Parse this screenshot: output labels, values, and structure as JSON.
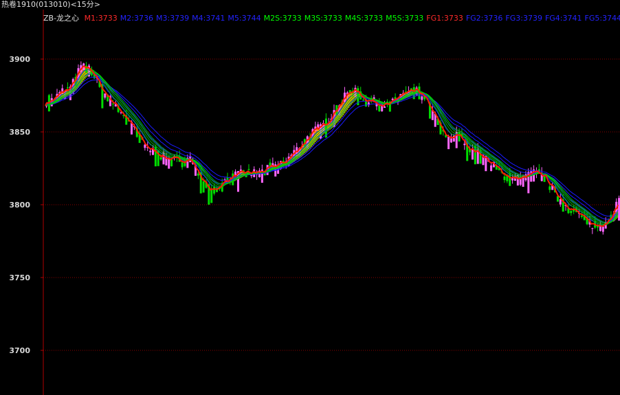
{
  "window": {
    "title": "热卷1910(013010)<15分>"
  },
  "indicator": {
    "name": "ZB-龙之心",
    "entries": [
      {
        "label": "M1:3733",
        "color": "#ff2a2a"
      },
      {
        "label": "M2:3736",
        "color": "#2323ff"
      },
      {
        "label": "M3:3739",
        "color": "#2323ff"
      },
      {
        "label": "M4:3741",
        "color": "#2323ff"
      },
      {
        "label": "M5:3744",
        "color": "#2323ff"
      },
      {
        "label": "M2S:3733",
        "color": "#00ff00"
      },
      {
        "label": "M3S:3733",
        "color": "#00ff00"
      },
      {
        "label": "M4S:3733",
        "color": "#00ff00"
      },
      {
        "label": "M5S:3733",
        "color": "#00ff00"
      },
      {
        "label": "FG1:3733",
        "color": "#ff2a2a"
      },
      {
        "label": "FG2:3736",
        "color": "#2323ff"
      },
      {
        "label": "FG3:3739",
        "color": "#2323ff"
      },
      {
        "label": "FG4:3741",
        "color": "#2323ff"
      },
      {
        "label": "FG5:3744",
        "color": "#2323ff"
      }
    ]
  },
  "colors": {
    "up_candle": "#ff66ff",
    "down_candle": "#00dd00",
    "grid": "#8b0000",
    "axis_text": "#d8d8d8",
    "ribbon_fill": "#ff9900",
    "ribbon_top": "#ff1a00",
    "blue_lines": "#1a1aff",
    "green_lines": "#00cc00"
  },
  "chart_data": {
    "type": "candlestick",
    "y_ticks": [
      "3900",
      "3850",
      "3800",
      "3750",
      "3700"
    ],
    "y_tick_values": [
      3900,
      3850,
      3800,
      3750,
      3700
    ],
    "ylim": [
      3690,
      3930
    ],
    "grid": true,
    "close_anchors": [
      [
        0,
        3871
      ],
      [
        5,
        3872
      ],
      [
        12,
        3878
      ],
      [
        18,
        3880
      ],
      [
        26,
        3895
      ],
      [
        34,
        3893
      ],
      [
        42,
        3878
      ],
      [
        50,
        3870
      ],
      [
        58,
        3862
      ],
      [
        66,
        3852
      ],
      [
        74,
        3840
      ],
      [
        82,
        3836
      ],
      [
        90,
        3832
      ],
      [
        100,
        3830
      ],
      [
        108,
        3832
      ],
      [
        116,
        3818
      ],
      [
        124,
        3808
      ],
      [
        132,
        3815
      ],
      [
        140,
        3820
      ],
      [
        150,
        3822
      ],
      [
        160,
        3822
      ],
      [
        170,
        3826
      ],
      [
        180,
        3830
      ],
      [
        190,
        3840
      ],
      [
        200,
        3850
      ],
      [
        210,
        3856
      ],
      [
        220,
        3870
      ],
      [
        230,
        3880
      ],
      [
        240,
        3872
      ],
      [
        250,
        3870
      ],
      [
        258,
        3868
      ],
      [
        266,
        3876
      ],
      [
        274,
        3877
      ],
      [
        280,
        3878
      ],
      [
        286,
        3870
      ],
      [
        292,
        3860
      ],
      [
        300,
        3845
      ],
      [
        310,
        3848
      ],
      [
        318,
        3838
      ],
      [
        326,
        3835
      ],
      [
        334,
        3828
      ],
      [
        342,
        3822
      ],
      [
        350,
        3818
      ],
      [
        358,
        3818
      ],
      [
        366,
        3822
      ],
      [
        374,
        3820
      ],
      [
        382,
        3808
      ],
      [
        390,
        3800
      ],
      [
        398,
        3795
      ],
      [
        406,
        3788
      ],
      [
        414,
        3785
      ],
      [
        422,
        3790
      ],
      [
        430,
        3803
      ]
    ],
    "candle_count": 431
  }
}
